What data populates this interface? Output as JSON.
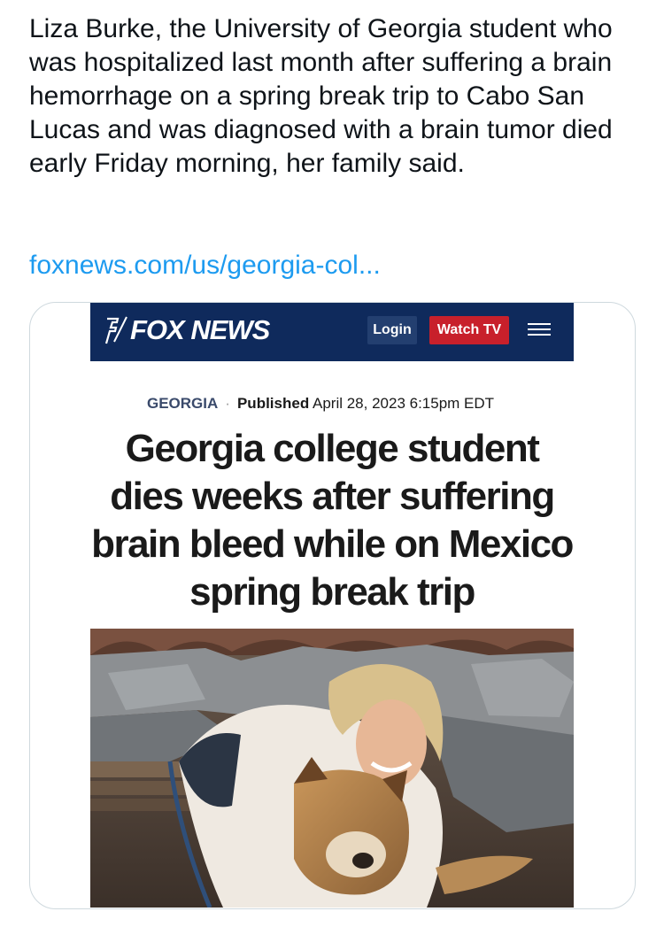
{
  "post": {
    "text": "Liza Burke, the University of Georgia student who was hospitalized last month after suffering a brain hemorrhage on a spring break trip to Cabo San Lucas and was diagnosed with a brain tumor died early Friday morning, her family said.",
    "link": "foxnews.com/us/georgia-col..."
  },
  "article": {
    "logo_text": "FOX NEWS",
    "login_label": "Login",
    "watch_label": "Watch TV",
    "category": "GEORGIA",
    "separator": "·",
    "published_label": "Published",
    "published_date": "April 28, 2023 6:15pm EDT",
    "headline": "Georgia college student dies weeks after suffering brain bleed while on Mexico spring break trip"
  },
  "colors": {
    "link": "#1d9bf0",
    "nav_bg": "#0f2a5c",
    "watch_btn": "#c8202b",
    "login_btn": "#233f70"
  },
  "icons": {
    "menu": "hamburger-menu-icon",
    "logo": "fox-news-logo"
  }
}
